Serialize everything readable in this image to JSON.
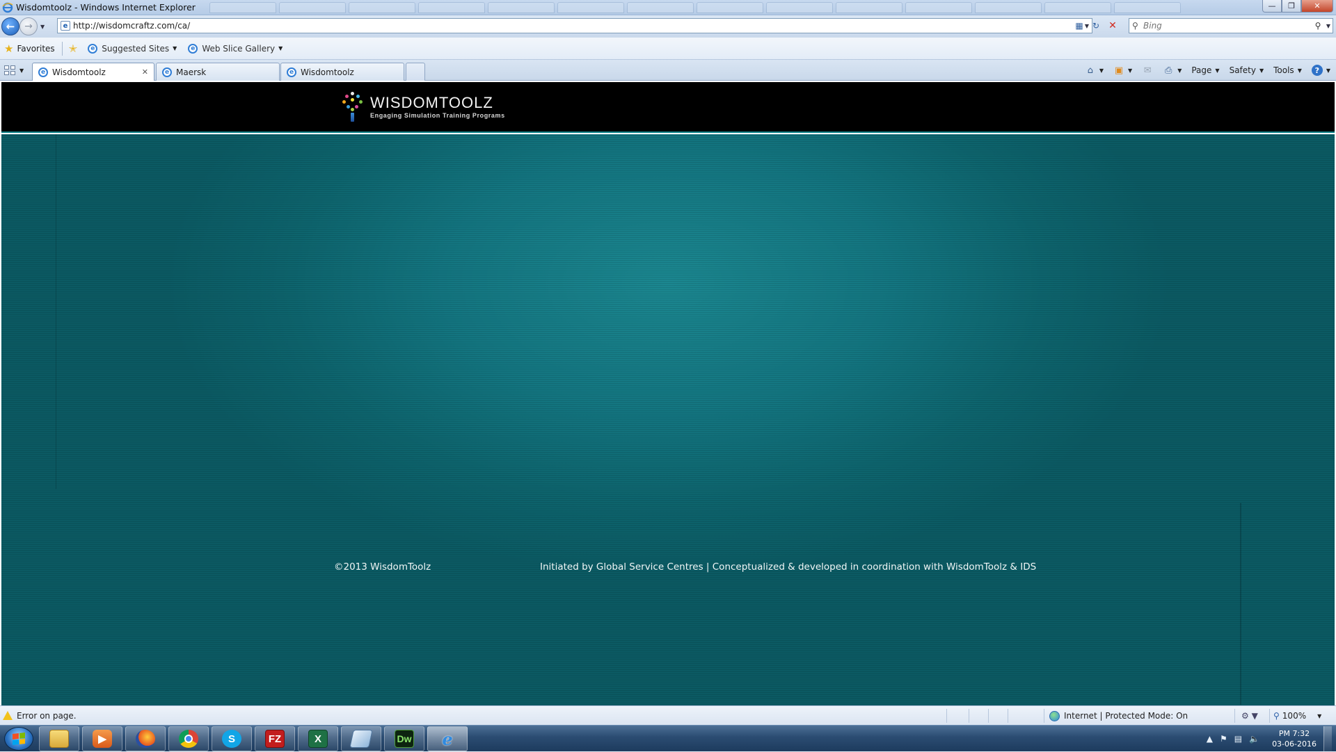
{
  "window": {
    "title": "Wisdomtoolz - Windows Internet Explorer"
  },
  "address_bar": {
    "url": "http://wisdomcraftz.com/ca/"
  },
  "search": {
    "placeholder": "Bing"
  },
  "favorites_bar": {
    "favorites_label": "Favorites",
    "items": [
      {
        "label": "Suggested Sites"
      },
      {
        "label": "Web Slice Gallery"
      }
    ]
  },
  "tabs": [
    {
      "label": "Wisdomtoolz",
      "active": true
    },
    {
      "label": "Maersk",
      "active": false
    },
    {
      "label": "Wisdomtoolz",
      "active": false
    }
  ],
  "command_bar": {
    "page": "Page",
    "safety": "Safety",
    "tools": "Tools"
  },
  "site": {
    "brand": "WISDOMTOOLZ",
    "tagline": "Engaging Simulation Training Programs",
    "footer_copyright": "©2013 WisdomToolz",
    "footer_credits": "Initiated by Global Service Centres | Conceptualized & developed in coordination with WisdomToolz & IDS",
    "colors": {
      "header": "#000000",
      "body_teal": "#137580",
      "accent_line": "#0e7f86"
    }
  },
  "status_bar": {
    "message": "Error on page.",
    "zone": "Internet | Protected Mode: On",
    "zoom": "100%"
  },
  "taskbar": {
    "apps": [
      {
        "icon": "folder-icon"
      },
      {
        "icon": "media-player-icon"
      },
      {
        "icon": "firefox-icon"
      },
      {
        "icon": "chrome-icon"
      },
      {
        "icon": "skype-icon"
      },
      {
        "icon": "filezilla-icon",
        "text": "FZ"
      },
      {
        "icon": "excel-icon",
        "text": "X"
      },
      {
        "icon": "notepad-icon"
      },
      {
        "icon": "dreamweaver-icon",
        "text": "Dw"
      },
      {
        "icon": "internet-explorer-icon",
        "text": "e"
      }
    ],
    "clock_time": "PM 7:32",
    "clock_date": "03-06-2016"
  }
}
